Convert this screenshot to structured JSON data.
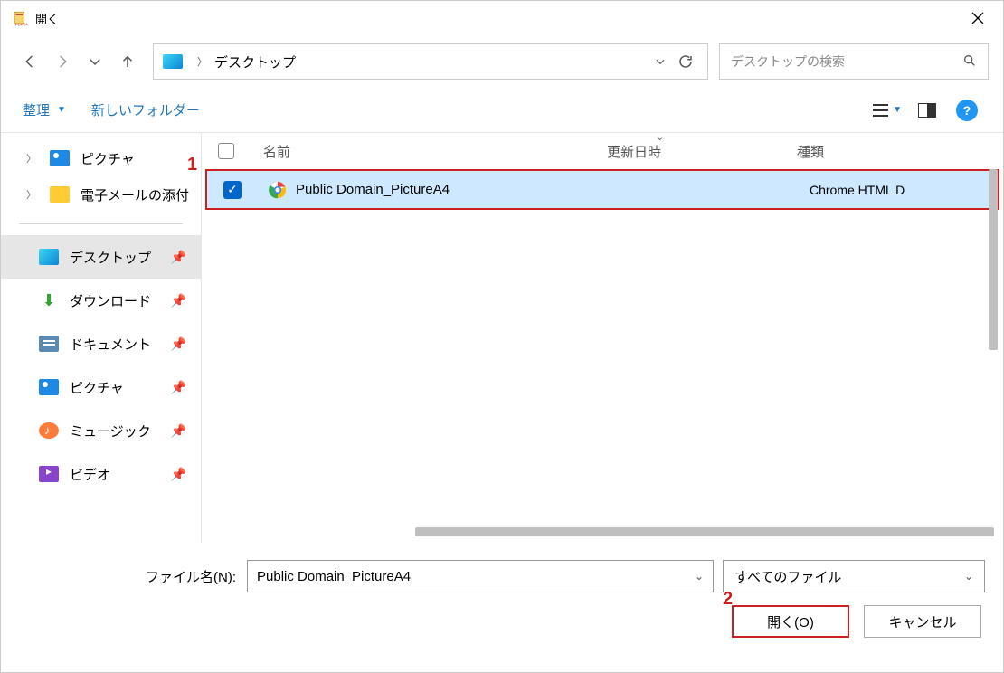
{
  "window": {
    "title": "開く"
  },
  "nav": {
    "breadcrumb_location": "デスクトップ",
    "search_placeholder": "デスクトップの検索"
  },
  "toolbar": {
    "organize": "整理",
    "new_folder": "新しいフォルダー"
  },
  "tree": {
    "top": [
      {
        "label": "ピクチャ"
      },
      {
        "label": "電子メールの添付"
      }
    ],
    "quick": [
      {
        "label": "デスクトップ",
        "active": true
      },
      {
        "label": "ダウンロード"
      },
      {
        "label": "ドキュメント"
      },
      {
        "label": "ピクチャ"
      },
      {
        "label": "ミュージック"
      },
      {
        "label": "ビデオ"
      }
    ]
  },
  "columns": {
    "name": "名前",
    "date": "更新日時",
    "type": "種類"
  },
  "files": [
    {
      "name": "Public Domain_PictureA4",
      "date": "",
      "type": "Chrome HTML D",
      "checked": true
    }
  ],
  "filename": {
    "label": "ファイル名(N):",
    "value": "Public Domain_PictureA4"
  },
  "filter": {
    "value": "すべてのファイル"
  },
  "buttons": {
    "open": "開く(O)",
    "cancel": "キャンセル"
  },
  "annotations": {
    "one": "1",
    "two": "2"
  }
}
